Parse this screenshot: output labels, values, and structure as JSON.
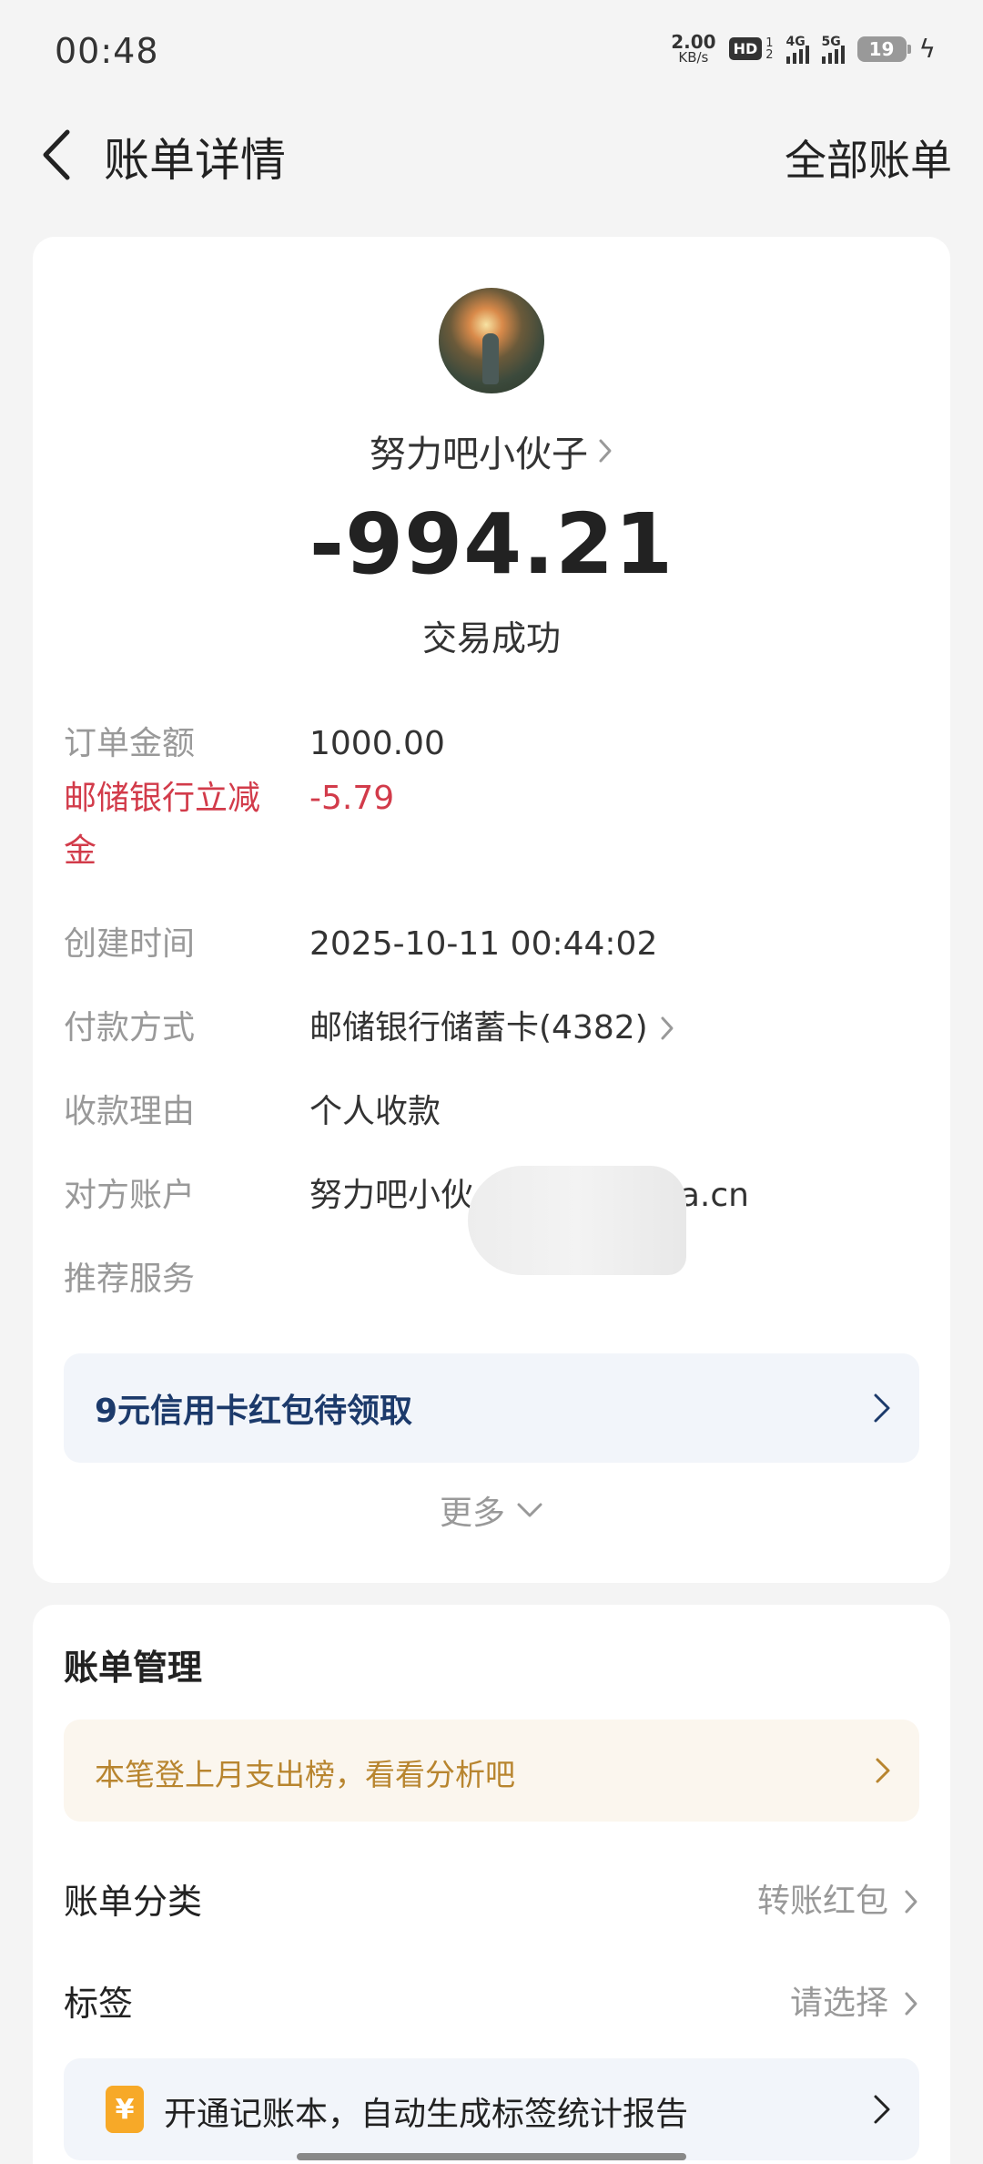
{
  "status_bar": {
    "time": "00:48",
    "net_speed_value": "2.00",
    "net_speed_unit": "KB/s",
    "hd_label": "HD",
    "hd_sub_top": "1",
    "hd_sub_bottom": "2",
    "signal_1_label": "4G",
    "signal_2_label": "5G",
    "battery": "19"
  },
  "header": {
    "title": "账单详情",
    "right_link": "全部账单"
  },
  "transaction": {
    "payee": "努力吧小伙子",
    "amount": "-994.21",
    "status": "交易成功"
  },
  "details": [
    {
      "label": "订单金额",
      "value": "1000.00"
    },
    {
      "label_line1": "邮储银行立减",
      "label_line2": "金",
      "value": "-5.79"
    },
    {
      "label": "创建时间",
      "value": "2025-10-11 00:44:02"
    },
    {
      "label": "付款方式",
      "value": "邮储银行储蓄卡(4382)"
    },
    {
      "label": "收款理由",
      "value": "个人收款"
    },
    {
      "label": "对方账户",
      "value_left": "努力吧小伙",
      "value_right": "ina.cn"
    },
    {
      "label": "推荐服务"
    }
  ],
  "promo": {
    "text": "9元信用卡红包待领取"
  },
  "more": {
    "label": "更多"
  },
  "management": {
    "title": "账单管理",
    "tip": "本笔登上月支出榜，看看分析吧",
    "category_label": "账单分类",
    "category_value": "转账红包",
    "tag_label": "标签",
    "tag_value": "请选择",
    "ledger_icon": "¥",
    "ledger_text": "开通记账本，自动生成标签统计报告"
  },
  "colors": {
    "discount_red": "#d23b4a",
    "promo_blue": "#1c3a6b",
    "tip_gold": "#b8852f",
    "coin_orange": "#f7a928"
  }
}
